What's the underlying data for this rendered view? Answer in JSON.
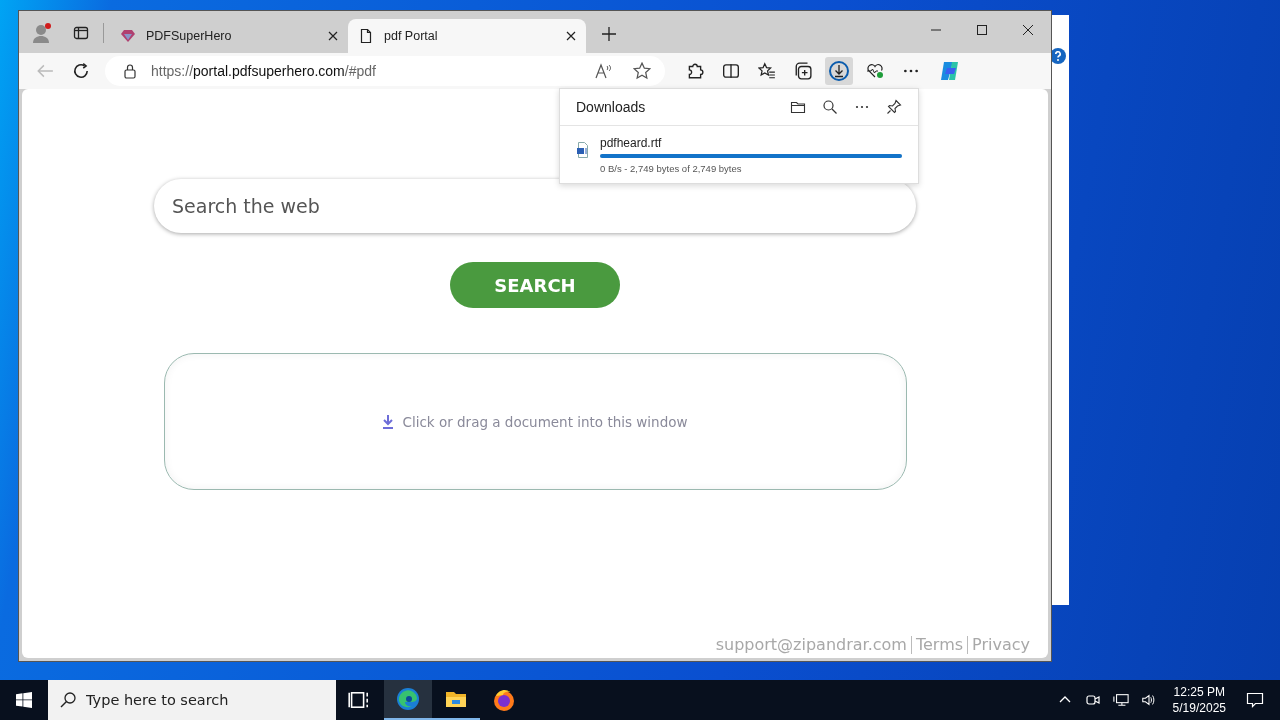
{
  "browser": {
    "tabs": [
      {
        "title": "PDFSuperHero",
        "kind": "site",
        "selected": false
      },
      {
        "title": "pdf Portal",
        "kind": "page",
        "selected": true
      }
    ],
    "address": {
      "scheme": "https://",
      "host": "portal.pdfsuperhero.com",
      "path": "/#pdf"
    }
  },
  "downloads": {
    "title": "Downloads",
    "items": [
      {
        "name": "pdfheard.rtf",
        "level": 1,
        "status": "0 B/s - 2,749 bytes of 2,749 bytes"
      }
    ]
  },
  "page": {
    "search": {
      "placeholder": "Search the web"
    },
    "search_button": "SEARCH",
    "drop_zone": "Click or drag a document into this window",
    "footer": [
      "support@zipandrar.com",
      "Terms",
      "Privacy"
    ]
  },
  "taskbar": {
    "search_placeholder": "Type here to search",
    "apps": [
      {
        "kind": "task-view",
        "active": false,
        "running": false
      },
      {
        "kind": "edge",
        "active": true,
        "running": true
      },
      {
        "kind": "explorer",
        "active": false,
        "running": true
      },
      {
        "kind": "firefox",
        "active": false,
        "running": false
      }
    ],
    "time": "12:25 PM",
    "date": "5/19/2025"
  }
}
